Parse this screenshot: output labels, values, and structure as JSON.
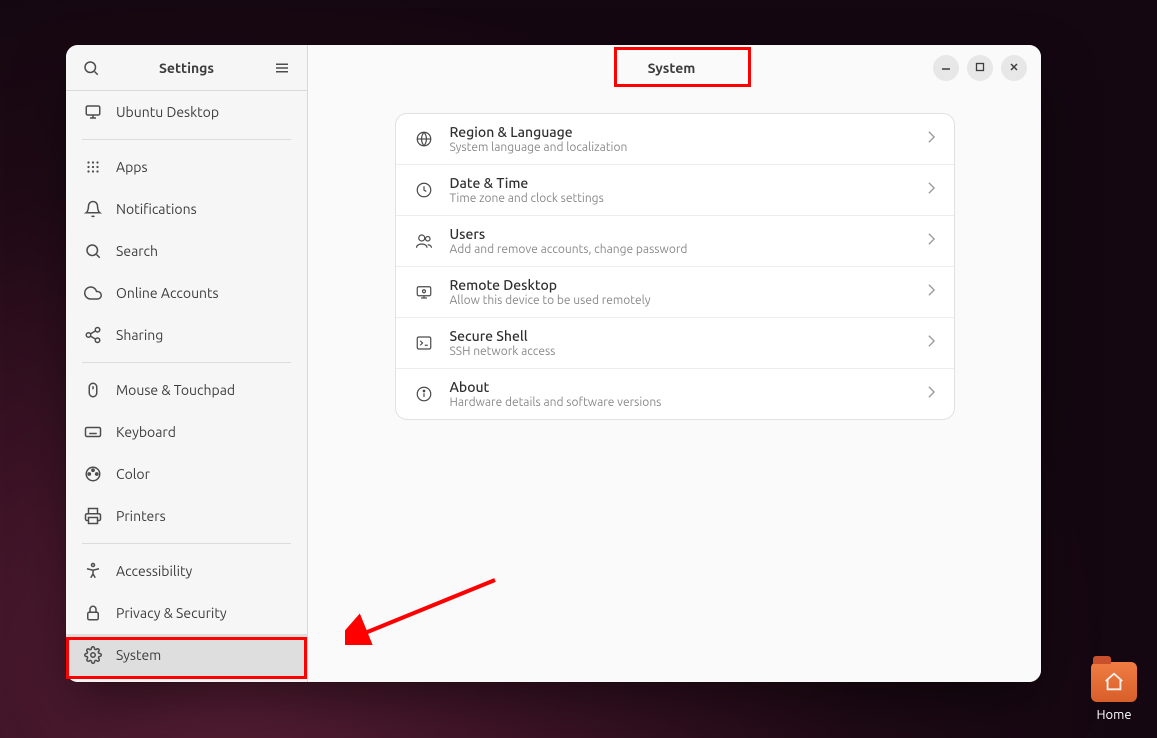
{
  "sidebar": {
    "title": "Settings",
    "items": [
      {
        "label": "Ubuntu Desktop"
      },
      {
        "label": "Apps"
      },
      {
        "label": "Notifications"
      },
      {
        "label": "Search"
      },
      {
        "label": "Online Accounts"
      },
      {
        "label": "Sharing"
      },
      {
        "label": "Mouse & Touchpad"
      },
      {
        "label": "Keyboard"
      },
      {
        "label": "Color"
      },
      {
        "label": "Printers"
      },
      {
        "label": "Accessibility"
      },
      {
        "label": "Privacy & Security"
      },
      {
        "label": "System"
      }
    ]
  },
  "header": {
    "title": "System"
  },
  "settings_panel": [
    {
      "title": "Region & Language",
      "subtitle": "System language and localization"
    },
    {
      "title": "Date & Time",
      "subtitle": "Time zone and clock settings"
    },
    {
      "title": "Users",
      "subtitle": "Add and remove accounts, change password"
    },
    {
      "title": "Remote Desktop",
      "subtitle": "Allow this device to be used remotely"
    },
    {
      "title": "Secure Shell",
      "subtitle": "SSH network access"
    },
    {
      "title": "About",
      "subtitle": "Hardware details and software versions"
    }
  ],
  "desktop": {
    "home_label": "Home"
  }
}
